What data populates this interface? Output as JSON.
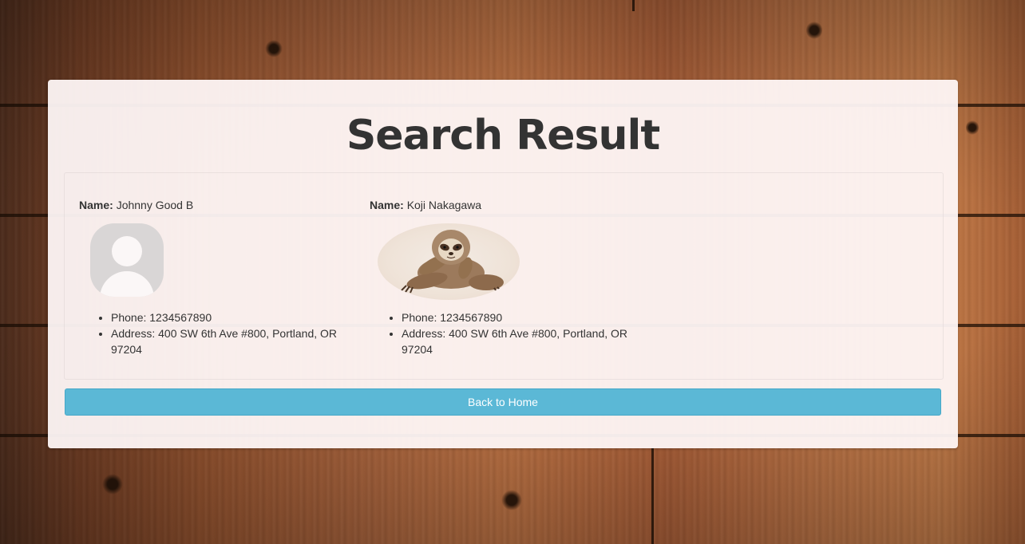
{
  "page": {
    "title": "Search Result"
  },
  "results": [
    {
      "name_label": "Name:",
      "name": "Johnny Good B",
      "avatar": "default-user-avatar-icon",
      "phone": "Phone: 1234567890",
      "address": "Address: 400 SW 6th Ave #800, Portland, OR 97204"
    },
    {
      "name_label": "Name:",
      "name": "Koji Nakagawa",
      "avatar": "sloth-photo",
      "phone": "Phone: 1234567890",
      "address": "Address: 400 SW 6th Ave #800, Portland, OR 97204"
    }
  ],
  "actions": {
    "back_home_label": "Back to Home"
  },
  "colors": {
    "button": "#5bb8d6",
    "title": "#333333",
    "panel": "#fff8f8"
  }
}
